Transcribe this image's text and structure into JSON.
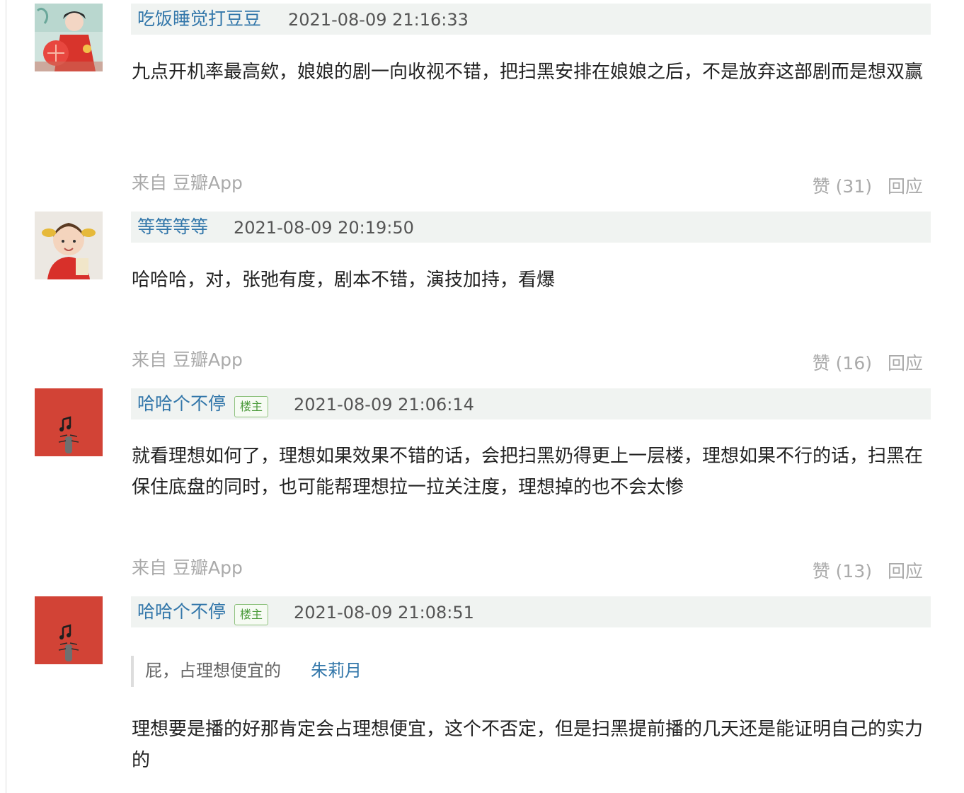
{
  "comments": [
    {
      "author": "吃饭睡觉打豆豆",
      "is_op": false,
      "time": "2021-08-09 21:16:33",
      "content": "九点开机率最高欸，娘娘的剧一向收视不错，把扫黑安排在娘娘之后，不是放弃这部剧而是想双赢",
      "source_prefix": "来自",
      "source_app": "豆瓣App",
      "like_label": "赞",
      "like_count": "(31)",
      "reply_label": "回应"
    },
    {
      "author": "等等等等",
      "is_op": false,
      "time": "2021-08-09 20:19:50",
      "content": "哈哈哈，对，张弛有度，剧本不错，演技加持，看爆",
      "source_prefix": "来自",
      "source_app": "豆瓣App",
      "like_label": "赞",
      "like_count": "(16)",
      "reply_label": "回应"
    },
    {
      "author": "哈哈个不停",
      "is_op": true,
      "op_label": "楼主",
      "time": "2021-08-09 21:06:14",
      "content": "就看理想如何了，理想如果效果不错的话，会把扫黑奶得更上一层楼，理想如果不行的话，扫黑在保住底盘的同时，也可能帮理想拉一拉关注度，理想掉的也不会太惨",
      "source_prefix": "来自",
      "source_app": "豆瓣App",
      "like_label": "赞",
      "like_count": "(13)",
      "reply_label": "回应"
    },
    {
      "author": "哈哈个不停",
      "is_op": true,
      "op_label": "楼主",
      "time": "2021-08-09 21:08:51",
      "quote": {
        "text": "屁，占理想便宜的",
        "author": "朱莉月"
      },
      "content": "理想要是播的好那肯定会占理想便宜，这个不否定，但是扫黑提前播的几天还是能证明自己的实力的"
    }
  ],
  "colors": {
    "link": "#3377aa",
    "meta_bar": "#f0f3f1",
    "muted": "#aaaaaa",
    "op_badge_border": "#8fc27f",
    "op_badge_text": "#4a9a3a"
  }
}
